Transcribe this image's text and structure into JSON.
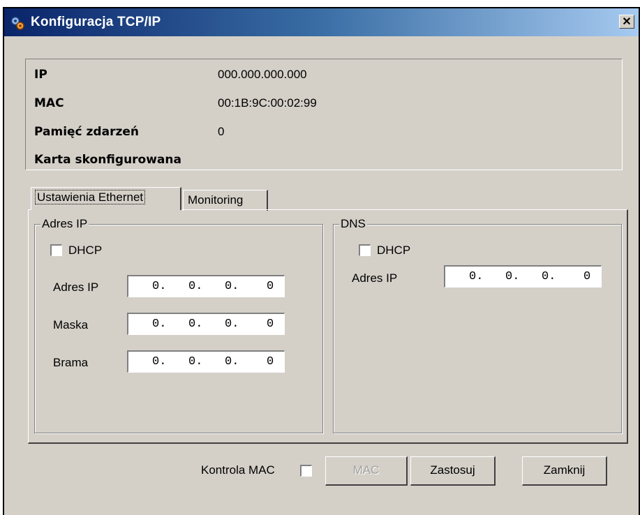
{
  "window": {
    "title": "Konfiguracja TCP/IP",
    "close_glyph": "✕"
  },
  "info": {
    "ip_label": "IP",
    "ip_value": "000.000.000.000",
    "mac_label": "MAC",
    "mac_value": "00:1B:9C:00:02:99",
    "events_label": "Pamięć zdarzeń",
    "events_value": "0",
    "status_label": "Karta skonfigurowana"
  },
  "tabs": [
    {
      "label": "Ustawienia Ethernet",
      "active": true
    },
    {
      "label": "Monitoring",
      "active": false
    }
  ],
  "ip_group": {
    "title": "Adres IP",
    "dhcp_label": "DHCP",
    "dhcp_checked": false,
    "fields": [
      {
        "label": "Adres IP",
        "octets": [
          "0.",
          "0.",
          "0.",
          "0"
        ]
      },
      {
        "label": "Maska",
        "octets": [
          "0.",
          "0.",
          "0.",
          "0"
        ]
      },
      {
        "label": "Brama",
        "octets": [
          "0.",
          "0.",
          "0.",
          "0"
        ]
      }
    ]
  },
  "dns_group": {
    "title": "DNS",
    "dhcp_label": "DHCP",
    "dhcp_checked": false,
    "ip_label": "Adres IP",
    "octets": [
      "0.",
      "0.",
      "0.",
      "0"
    ]
  },
  "footer": {
    "mac_control_label": "Kontrola MAC",
    "mac_control_checked": false,
    "mac_button": "MAC",
    "mac_button_enabled": false,
    "apply_button": "Zastosuj",
    "close_button": "Zamknij"
  }
}
